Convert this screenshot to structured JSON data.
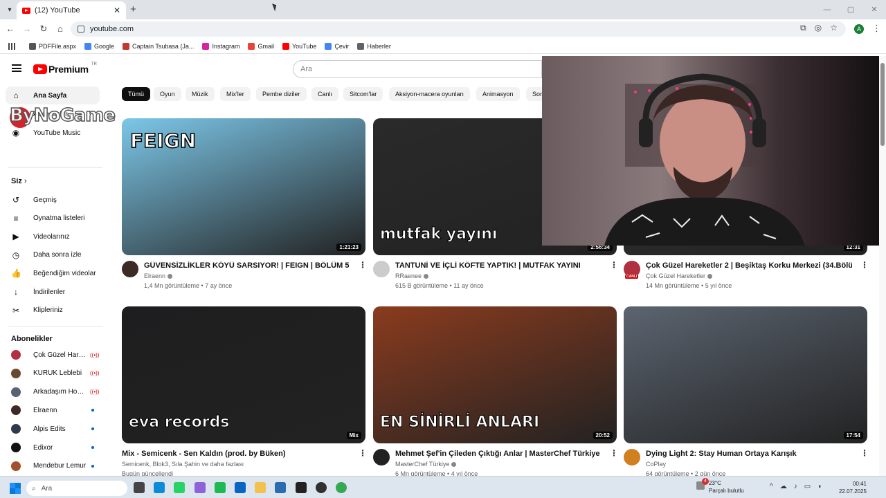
{
  "browser": {
    "tab_title": "(12) YouTube",
    "url": "youtube.com",
    "profile_initial": "A",
    "bookmarks": [
      {
        "label": "PDFFile.aspx",
        "color": "#555555"
      },
      {
        "label": "Google",
        "color": "#4285f4"
      },
      {
        "label": "Captain Tsubasa (Ja...",
        "color": "#c0392b"
      },
      {
        "label": "Instagram",
        "color": "#d6249f"
      },
      {
        "label": "Gmail",
        "color": "#ea4335"
      },
      {
        "label": "YouTube",
        "color": "#ff0000"
      },
      {
        "label": "Çevir",
        "color": "#4285f4"
      },
      {
        "label": "Haberler",
        "color": "#5f6368"
      }
    ]
  },
  "youtube": {
    "logo_text": "Premium",
    "logo_country": "TR",
    "search_placeholder": "Ara",
    "sidebar": {
      "main": [
        {
          "label": "Ana Sayfa",
          "icon": "home-icon",
          "glyph": "⌂",
          "active": true
        },
        {
          "label": "Abonelikler",
          "icon": "subscriptions-icon",
          "glyph": "▤"
        },
        {
          "label": "YouTube Music",
          "icon": "music-icon",
          "glyph": "◉"
        }
      ],
      "you_heading": "Siz",
      "you_items": [
        {
          "label": "Geçmiş",
          "icon": "history-icon",
          "glyph": "↺"
        },
        {
          "label": "Oynatma listeleri",
          "icon": "playlists-icon",
          "glyph": "≡"
        },
        {
          "label": "Videolarınız",
          "icon": "your-videos-icon",
          "glyph": "▶"
        },
        {
          "label": "Daha sonra izle",
          "icon": "watch-later-icon",
          "glyph": "◷"
        },
        {
          "label": "Beğendiğim videolar",
          "icon": "liked-icon",
          "glyph": "👍"
        },
        {
          "label": "İndirilenler",
          "icon": "downloads-icon",
          "glyph": "↓"
        },
        {
          "label": "Klipleriniz",
          "icon": "clips-icon",
          "glyph": "✂"
        }
      ],
      "subs_heading": "Abonelikler",
      "subscriptions": [
        {
          "label": "Çok Güzel Harek...",
          "status": "live",
          "color": "#b03040"
        },
        {
          "label": "KURUK Leblebi",
          "status": "live",
          "color": "#6b4a2b"
        },
        {
          "label": "Arkadaşım Hoşg...",
          "status": "live",
          "color": "#5a6470"
        },
        {
          "label": "Elraenn",
          "status": "new",
          "color": "#3b2a25"
        },
        {
          "label": "Alpis Edits",
          "status": "new",
          "color": "#2f3b4a"
        },
        {
          "label": "Edixor",
          "status": "new",
          "color": "#111111"
        },
        {
          "label": "Mendebur Lemur",
          "status": "new",
          "color": "#a0522d"
        }
      ],
      "live_glyph": "((•))"
    },
    "chips": [
      "Tümü",
      "Oyun",
      "Müzik",
      "Mix'ler",
      "Pembe diziler",
      "Canlı",
      "Sitcom'lar",
      "Aksiyon-macera oyunları",
      "Animasyon",
      "Son"
    ],
    "videos": [
      {
        "title": "GÜVENSİZLİKLER KÖYÜ SARSIYOR! | FEIGN | BÖLÜM 5",
        "channel": "Elraenn",
        "verified": true,
        "meta": "1,4 Mn görüntüleme • 7 ay önce",
        "duration": "1:21:23",
        "thumb_text": "FEIGN",
        "color": "#7cc7e8",
        "avatar": "#3b2a25"
      },
      {
        "title": "TANTUNİ VE İÇLİ KÖFTE YAPTIK! | MUTFAK YAYINI",
        "channel": "RRaenee",
        "verified": true,
        "meta": "615 B görüntüleme • 11 ay önce",
        "duration": "2:56:34",
        "thumb_text": "mutfak yayını",
        "color": "#2a2a2a",
        "avatar": "#cccccc"
      },
      {
        "title": "Çok Güzel Hareketler 2 | Beşiktaş Korku Merkezi (34.Bölüm)",
        "channel": "Çok Güzel Hareketler",
        "verified": true,
        "meta": "14 Mn görüntüleme • 5 yıl önce",
        "duration": "12:31",
        "thumb_text": "",
        "color": "#333333",
        "avatar": "#b03040",
        "avatar_label": "CANLI"
      },
      {
        "title": "Mix - Semicenk - Sen Kaldın (prod. by Büken)",
        "channel": "Semicenk, Blok3, Sıla Şahin ve daha fazlası",
        "verified": false,
        "meta": "Bugün güncellendi",
        "duration": "Mix",
        "thumb_text": "eva records",
        "color": "#1e1e20",
        "avatar": ""
      },
      {
        "title": "Mehmet Şef'in Çileden Çıktığı Anlar | MasterChef Türkiye",
        "channel": "MasterChef Türkiye",
        "verified": true,
        "meta": "6 Mn görüntüleme • 4 yıl önce",
        "duration": "20:52",
        "thumb_text": "EN SİNİRLİ ANLARI",
        "color": "#8a3b1e",
        "avatar": "#222222"
      },
      {
        "title": "Dying Light 2: Stay Human Ortaya Karışık",
        "channel": "CoPlay",
        "verified": false,
        "meta": "64 görüntüleme • 2 gün önce",
        "duration": "17:54",
        "thumb_text": "",
        "color": "#5b6470",
        "avatar": "#d08020"
      }
    ]
  },
  "overlay": {
    "watermark": "ByNoGame"
  },
  "taskbar": {
    "search": "Ara",
    "weather_temp": "23°C",
    "weather_desc": "Parçalı bulutlu",
    "weather_badge": "4",
    "time": "00:41",
    "date": "22.07.2025",
    "apps": [
      {
        "name": "taskview-icon",
        "color": "#444444"
      },
      {
        "name": "edge-icon",
        "color": "#0c8bd6"
      },
      {
        "name": "whatsapp-icon",
        "color": "#25d366"
      },
      {
        "name": "copilot-icon",
        "color": "#8e62d9"
      },
      {
        "name": "spotify-icon",
        "color": "#1db954"
      },
      {
        "name": "outlook-icon",
        "color": "#0a64c4"
      },
      {
        "name": "explorer-icon",
        "color": "#f2c14e"
      },
      {
        "name": "store-icon",
        "color": "#2b6cb0"
      },
      {
        "name": "epic-icon",
        "color": "#222222"
      },
      {
        "name": "obs-icon",
        "color": "#303030"
      },
      {
        "name": "chrome-icon",
        "color": "#34a853"
      }
    ]
  }
}
